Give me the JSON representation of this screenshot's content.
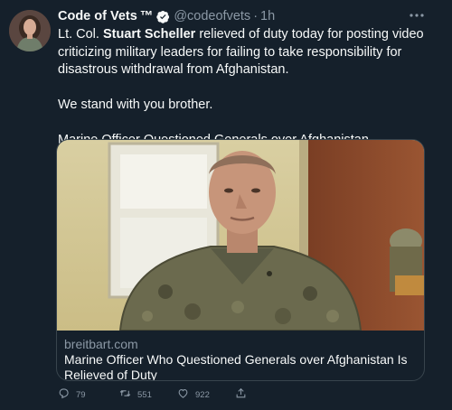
{
  "tweet": {
    "author_name": "Code of Vets",
    "tm": "™",
    "handle": "@codeofvets",
    "separator": "·",
    "time": "1h",
    "text_before_bold": "Lt. Col. ",
    "bold_name": "Stuart Scheller",
    "text_after_bold": " relieved of duty today for posting video criticizing military leaders for failing to take responsibility for disastrous withdrawal from Afghanistan.",
    "line2": "We stand with you brother.",
    "line3": "Marine Officer Questioned Generals over Afghanistan"
  },
  "link_card": {
    "domain": "breitbart.com",
    "title": "Marine Officer Who Questioned Generals over Afghanistan Is Relieved of Duty"
  },
  "actions": {
    "replies": "79",
    "retweets": "551",
    "likes": "922"
  },
  "icons": {
    "verified": "verified-badge-icon",
    "more": "more-icon",
    "reply": "reply-icon",
    "retweet": "retweet-icon",
    "like": "like-icon",
    "share": "share-icon"
  },
  "colors": {
    "background": "#15202b",
    "text": "#f7f9f9",
    "secondary": "#8b98a5",
    "border": "#38444d"
  }
}
